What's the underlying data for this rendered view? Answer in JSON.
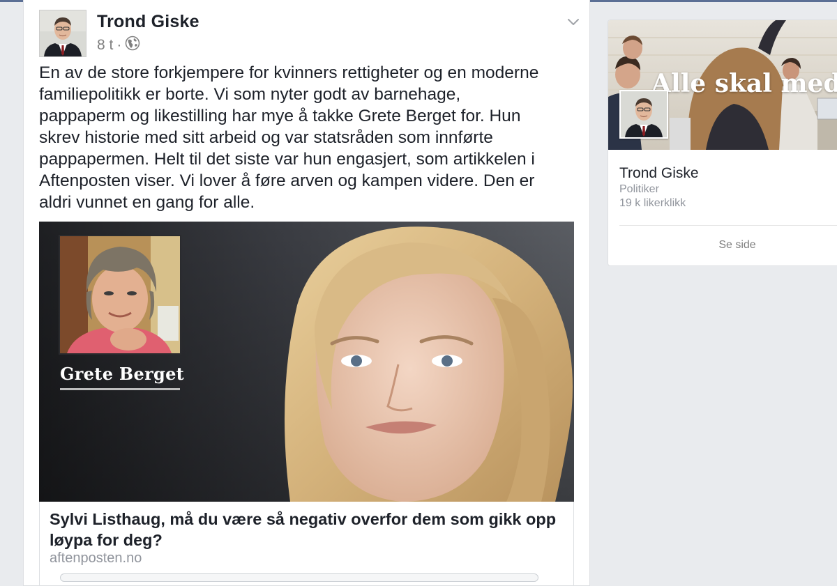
{
  "post": {
    "author": "Trond Giske",
    "time": "8 t",
    "separator": "·",
    "text": "En av de store forkjempere for kvinners rettigheter og en moderne\nfamiliepolitikk er borte. Vi som nyter godt av barnehage,\npappaperm og likestilling har mye å takke Grete Berget for. Hun\nskrev historie med sitt arbeid og var statsråden som innførte\npappapermen. Helt til det siste var hun engasjert, som artikkelen i\nAftenposten viser. Vi lover å føre arven og kampen videre. Den er\naldri vunnet en gang for alle.",
    "link": {
      "inset_name": "Grete Berget",
      "title": "Sylvi Listhaug, må du være så negativ overfor dem som gikk opp løypa for deg?",
      "domain": "aftenposten.no"
    },
    "icons": [
      "globe-icon",
      "chevron-down-icon"
    ]
  },
  "page_card": {
    "cover_slogan": "Alle skal med.",
    "name": "Trond Giske",
    "category": "Politiker",
    "likes": "19 k likerklikk",
    "see_page": "Se side"
  }
}
